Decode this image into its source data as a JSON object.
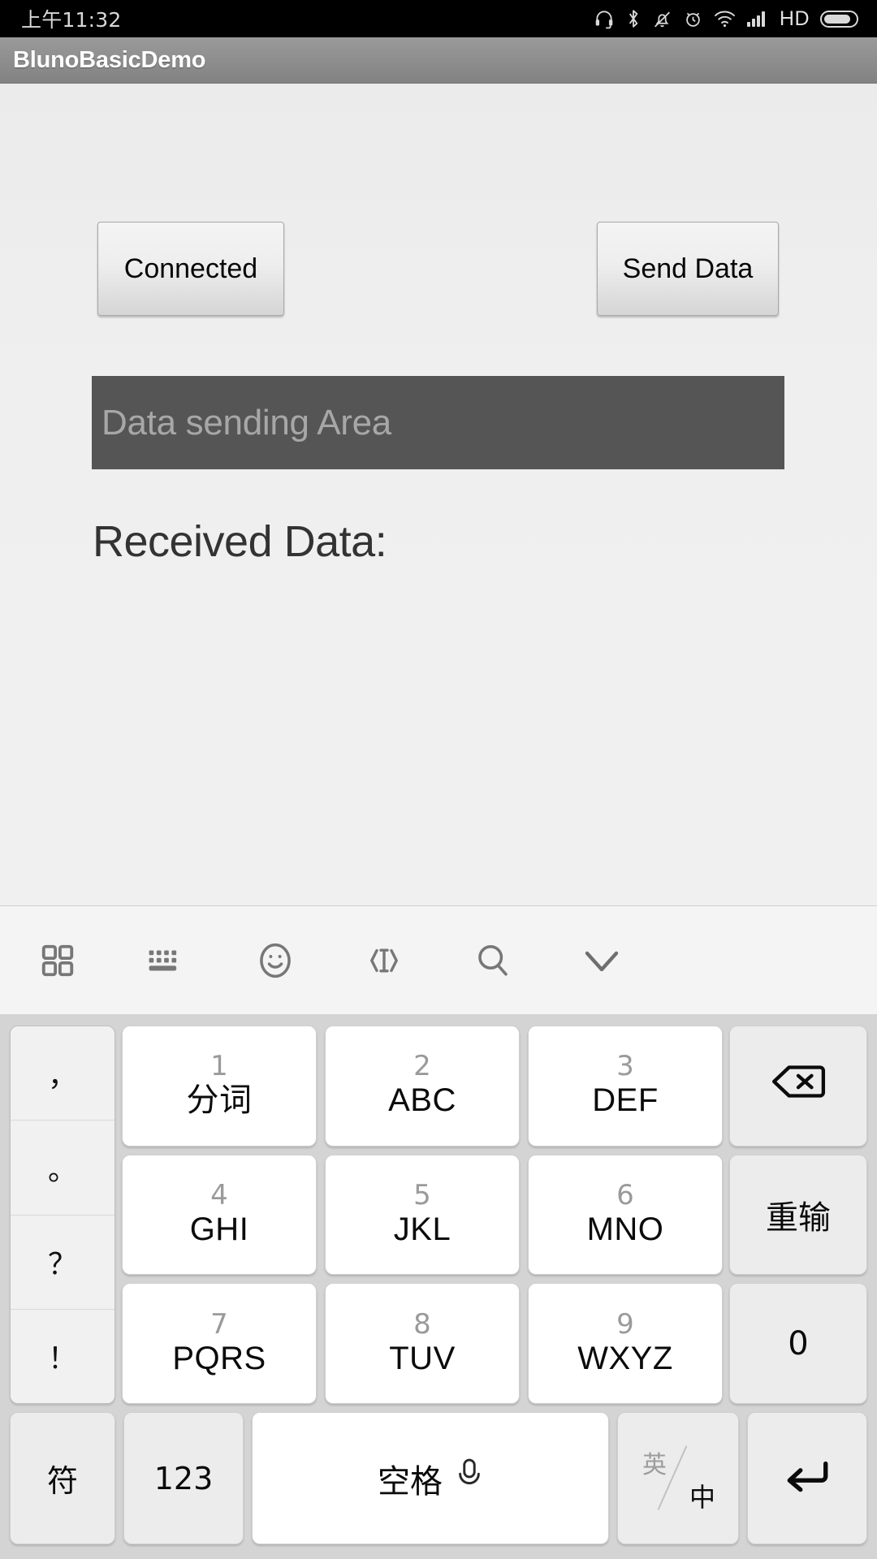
{
  "status_bar": {
    "clock": "上午11:32",
    "hd_label": "HD",
    "icons": [
      "headset-icon",
      "bluetooth-icon",
      "mute-bell-icon",
      "alarm-icon",
      "wifi-icon",
      "signal-icon",
      "battery-icon"
    ]
  },
  "action_bar": {
    "title": "BlunoBasicDemo"
  },
  "app": {
    "connect_button": "Connected",
    "send_button": "Send Data",
    "send_field_placeholder": "Data sending Area",
    "send_field_value": "",
    "received_label": "Received Data:",
    "received_value": ""
  },
  "ime_toolbar": {
    "tools": [
      {
        "name": "apps-grid-icon"
      },
      {
        "name": "keyboard-icon"
      },
      {
        "name": "emoji-icon"
      },
      {
        "name": "text-cursor-icon"
      },
      {
        "name": "search-icon"
      }
    ],
    "collapse": {
      "name": "chevron-down-icon"
    }
  },
  "keyboard": {
    "punctuation": [
      "，",
      "。",
      "？",
      "！"
    ],
    "number_keys": [
      {
        "num": "1",
        "letters": "分词"
      },
      {
        "num": "2",
        "letters": "ABC"
      },
      {
        "num": "3",
        "letters": "DEF"
      },
      {
        "num": "4",
        "letters": "GHI"
      },
      {
        "num": "5",
        "letters": "JKL"
      },
      {
        "num": "6",
        "letters": "MNO"
      },
      {
        "num": "7",
        "letters": "PQRS"
      },
      {
        "num": "8",
        "letters": "TUV"
      },
      {
        "num": "9",
        "letters": "WXYZ"
      }
    ],
    "utility": [
      {
        "label": "",
        "icon": "backspace-icon"
      },
      {
        "label": "重输",
        "icon": ""
      },
      {
        "label": "0",
        "icon": ""
      }
    ],
    "bottom_row": {
      "symbol": "符",
      "numeric": "123",
      "space": "空格",
      "space_icon": "microphone-icon",
      "lang_en": "英",
      "lang_cn": "中",
      "enter_icon": "enter-arrow-icon"
    }
  },
  "colors": {
    "status_bg": "#000000",
    "action_bar": "#8d8d8d",
    "content_bg": "#efefef",
    "send_field_bg": "#555555",
    "keyboard_bg": "#d4d4d4",
    "key_white": "#ffffff",
    "key_gray": "#ececec"
  }
}
